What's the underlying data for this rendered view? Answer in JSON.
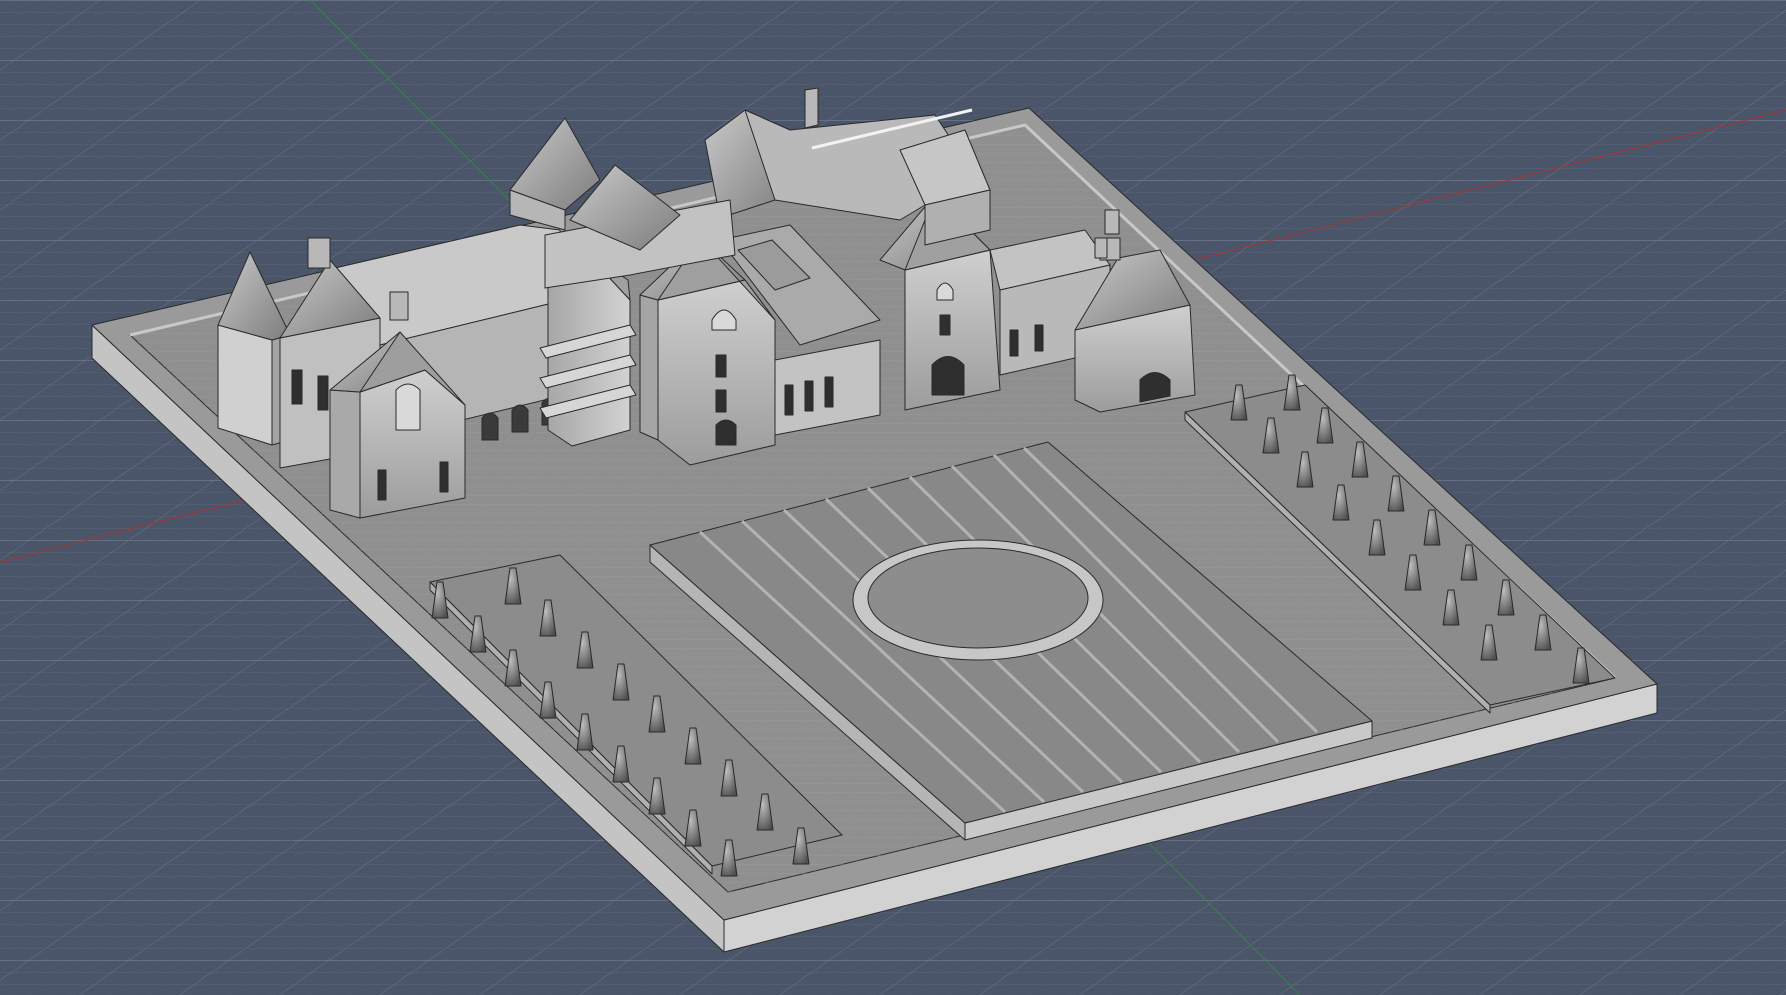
{
  "viewport": {
    "background": "#4a5569",
    "grid_minor_color": "#5a6579",
    "grid_major_color": "#6e7a90",
    "x_axis_color": "#b03030",
    "y_axis_color": "#2e8a3e"
  },
  "model": {
    "base_top_color": "#8e8e8e",
    "base_side_color": "#bdbdbd",
    "base_front_color": "#cfcfcf",
    "wall_color": "#b8b8b8",
    "roof_color": "#8a8a8a",
    "roof_dark_color": "#6e6e6e",
    "hedge_color": "#8c8c8c",
    "tree_color": "#7a7a7a",
    "parterre_color": "#8a8a8a",
    "edge_color": "#2a2a2a"
  }
}
